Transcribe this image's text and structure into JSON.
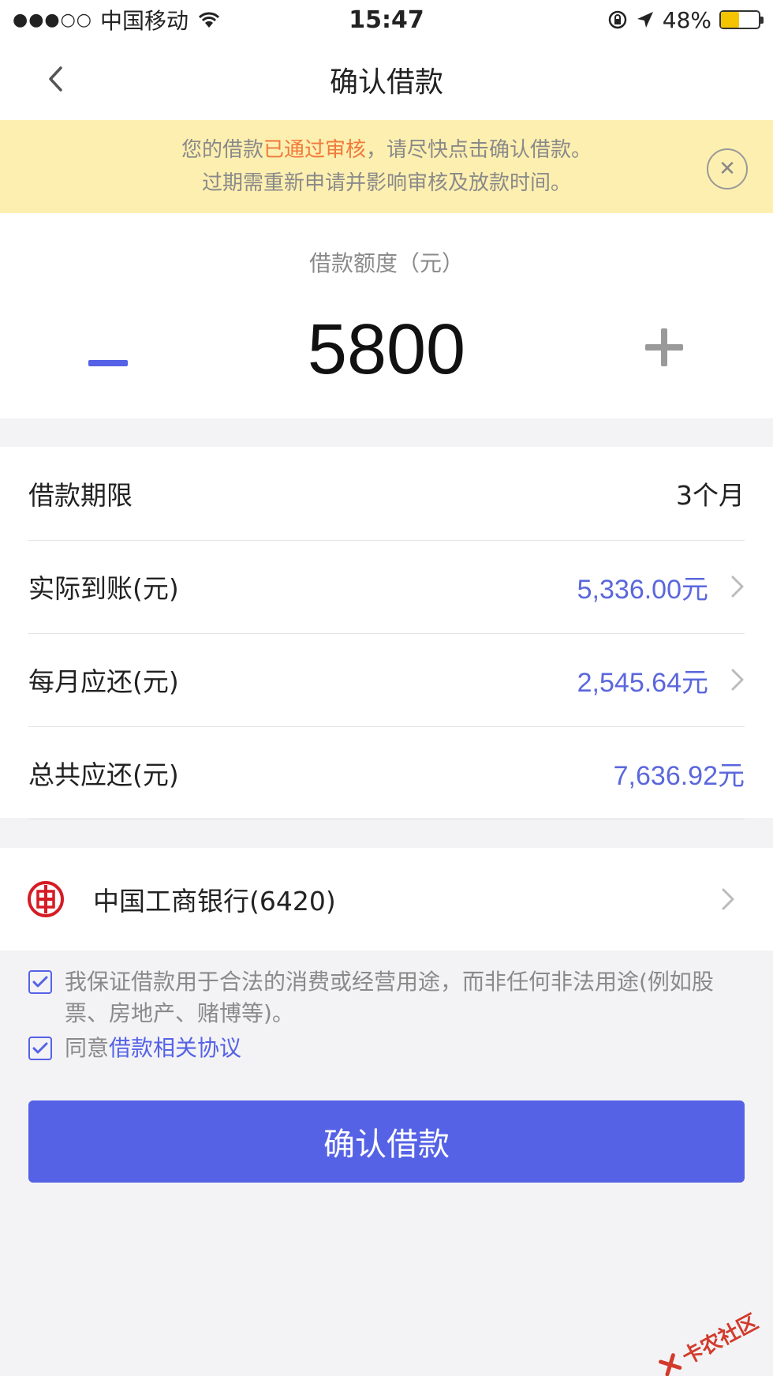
{
  "status_bar": {
    "signal": "●●●○○",
    "carrier": "中国移动",
    "time": "15:47",
    "battery_percent_label": "48%",
    "battery_level": 0.48,
    "battery_color": "#f5c400"
  },
  "nav": {
    "title": "确认借款",
    "back_icon": "chevron-left-icon"
  },
  "notice": {
    "line1_prefix": "您的借款",
    "line1_highlight": "已通过审核",
    "line1_suffix": "，请尽快点击确认借款。",
    "line2": "过期需重新申请并影响审核及放款时间。",
    "close_symbol": "✕",
    "highlight_color": "#f07a3a",
    "background": "#fdefb0"
  },
  "amount": {
    "label": "借款额度（元）",
    "value": "5800"
  },
  "details": [
    {
      "label": "借款期限",
      "value": "3个月"
    },
    {
      "label": "实际到账(元)",
      "value": "5,336.00元"
    },
    {
      "label": "每月应还(元)",
      "value": "2,545.64元"
    },
    {
      "label": "总共应还(元)",
      "value": "7,636.92元"
    }
  ],
  "bank": {
    "name": "中国工商银行(6420)",
    "logo_symbol": "工",
    "logo_color": "#d51c24"
  },
  "agreements": {
    "guarantee": "我保证借款用于合法的消费或经营用途，而非任何非法用途(例如股票、房地产、赌博等)。",
    "agree_prefix": "同意",
    "agree_link": "借款相关协议"
  },
  "confirm_button": "确认借款",
  "watermark": "卡农社区",
  "colors": {
    "accent": "#5562e6",
    "amount_text": "#5b67dc",
    "page_bg": "#f3f3f6"
  }
}
